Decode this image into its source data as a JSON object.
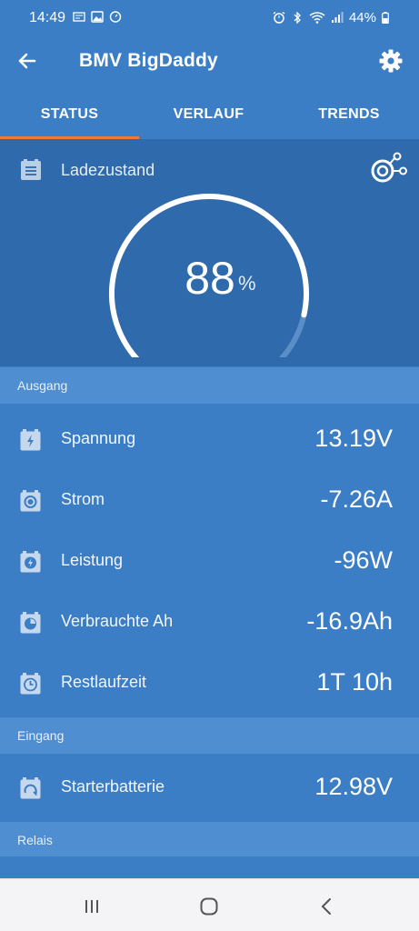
{
  "status_bar": {
    "time": "14:49",
    "battery": "44%",
    "left_icons": [
      "news-icon",
      "image-icon",
      "timer-icon"
    ],
    "right_icons": [
      "alarm-icon",
      "bluetooth-icon",
      "wifi-icon",
      "signal-icon",
      "battery-icon"
    ]
  },
  "app_bar": {
    "title": "BMV BigDaddy",
    "back_icon": "arrow-left-icon",
    "settings_icon": "gear-icon"
  },
  "tabs": [
    {
      "label": "STATUS",
      "active": true
    },
    {
      "label": "VERLAUF",
      "active": false
    },
    {
      "label": "TRENDS",
      "active": false
    }
  ],
  "colors": {
    "background": "#3b7ec5",
    "gauge_panel": "#2e6aac",
    "section_header": "#4e8ed1",
    "tab_indicator": "#f07a3a"
  },
  "state_of_charge": {
    "label": "Ladezustand",
    "value": "88",
    "unit": "%",
    "fraction": 0.88
  },
  "sections": {
    "ausgang": "Ausgang",
    "eingang": "Eingang",
    "relais": "Relais"
  },
  "ausgang_rows": [
    {
      "label": "Spannung",
      "value": "13.19V",
      "icon": "battery-bolt-icon"
    },
    {
      "label": "Strom",
      "value": "-7.26A",
      "icon": "battery-dot-icon"
    },
    {
      "label": "Leistung",
      "value": "-96W",
      "icon": "battery-power-icon"
    },
    {
      "label": "Verbrauchte Ah",
      "value": "-16.9Ah",
      "icon": "battery-pie-icon"
    },
    {
      "label": "Restlaufzeit",
      "value": "1T 10h",
      "icon": "battery-clock-icon"
    }
  ],
  "eingang_rows": [
    {
      "label": "Starterbatterie",
      "value": "12.98V",
      "icon": "battery-starter-icon"
    }
  ],
  "nav_bar": [
    "recent-apps-icon",
    "home-icon",
    "back-icon"
  ]
}
